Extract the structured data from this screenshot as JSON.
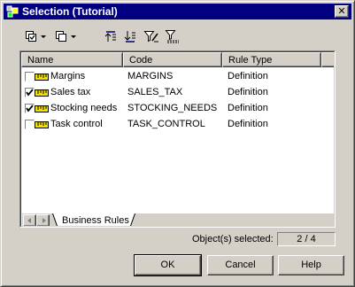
{
  "window": {
    "title": "Selection (Tutorial)"
  },
  "toolbar": {
    "icons": [
      "select-all-icon",
      "dropdown-arrow-icon",
      "deselect-all-icon",
      "dropdown-arrow-icon",
      "move-to-top-icon",
      "move-to-bottom-icon",
      "customize-columns-filter-icon",
      "filter-icon"
    ]
  },
  "list": {
    "columns": [
      "Name",
      "Code",
      "Rule Type"
    ],
    "rows": [
      {
        "name": "Margins",
        "code": "MARGINS",
        "type": "Definition",
        "checked": false
      },
      {
        "name": "Sales tax",
        "code": "SALES_TAX",
        "type": "Definition",
        "checked": true
      },
      {
        "name": "Stocking needs",
        "code": "STOCKING_NEEDS",
        "type": "Definition",
        "checked": true
      },
      {
        "name": "Task control",
        "code": "TASK_CONTROL",
        "type": "Definition",
        "checked": false
      }
    ],
    "row_icon": "business-rule-ruler-icon"
  },
  "tabs": [
    {
      "label": "Business Rules",
      "active": true
    }
  ],
  "status": {
    "label": "Object(s) selected:",
    "value": "2 / 4"
  },
  "buttons": {
    "ok": "OK",
    "cancel": "Cancel",
    "help": "Help"
  },
  "colors": {
    "title_bar": "#000080",
    "face": "#d4d0c8",
    "ruler": "#f0e000"
  }
}
